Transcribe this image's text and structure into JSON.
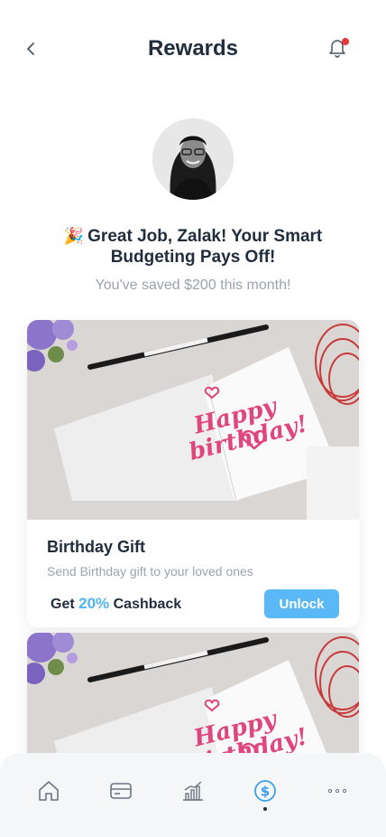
{
  "header": {
    "title": "Rewards"
  },
  "greeting": {
    "emoji": "🎉",
    "message": "Great Job, Zalak! Your Smart Budgeting Pays Off!",
    "subtext": "You've saved $200 this month!"
  },
  "rewards": [
    {
      "title": "Birthday Gift",
      "description": "Send Birthday gift to your loved ones",
      "cashback_prefix": "Get",
      "cashback_value": "20%",
      "cashback_suffix": "Cashback",
      "button_label": "Unlock",
      "image_text": [
        "Happy",
        "birthday!"
      ]
    },
    {
      "image_text": [
        "Happy",
        "birthday!"
      ]
    }
  ],
  "bottom_nav": {
    "items": [
      "home",
      "cards",
      "analytics",
      "rewards",
      "more"
    ],
    "active": "rewards"
  },
  "colors": {
    "accent": "#5bb8f6",
    "title": "#1f2d3d",
    "muted": "#9aa3ad",
    "notification": "#e53935",
    "card_script": "#e0457b"
  }
}
